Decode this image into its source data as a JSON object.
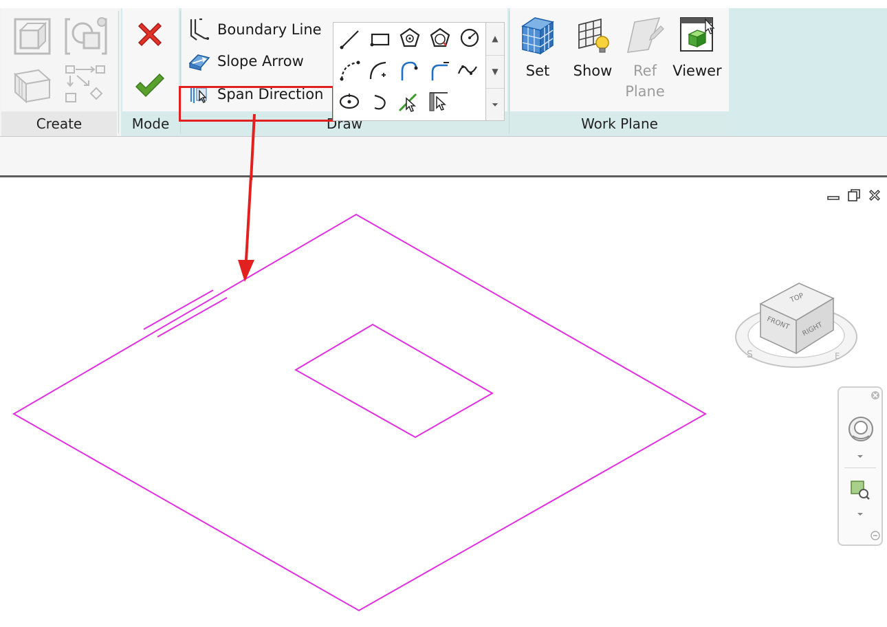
{
  "ribbon": {
    "panels": {
      "create": "Create",
      "mode": "Mode",
      "draw": "Draw",
      "work_plane": "Work Plane"
    },
    "draw_tools": {
      "boundary_line": "Boundary Line",
      "slope_arrow": "Slope Arrow",
      "span_direction": "Span Direction"
    },
    "work_plane": {
      "set": "Set",
      "show": "Show",
      "ref_plane_1": "Ref",
      "ref_plane_2": "Plane",
      "viewer": "Viewer"
    }
  },
  "highlight": {
    "target": "span-direction-button",
    "annotation_color": "#e32020"
  },
  "viewcube": {
    "top": "TOP",
    "front": "FRONT",
    "right": "RIGHT"
  },
  "colors": {
    "sketch_line": "#e030e0",
    "contextual_tab": "#d6ecec",
    "finish_check": "#5aa02c",
    "cancel_x": "#e0332a"
  }
}
